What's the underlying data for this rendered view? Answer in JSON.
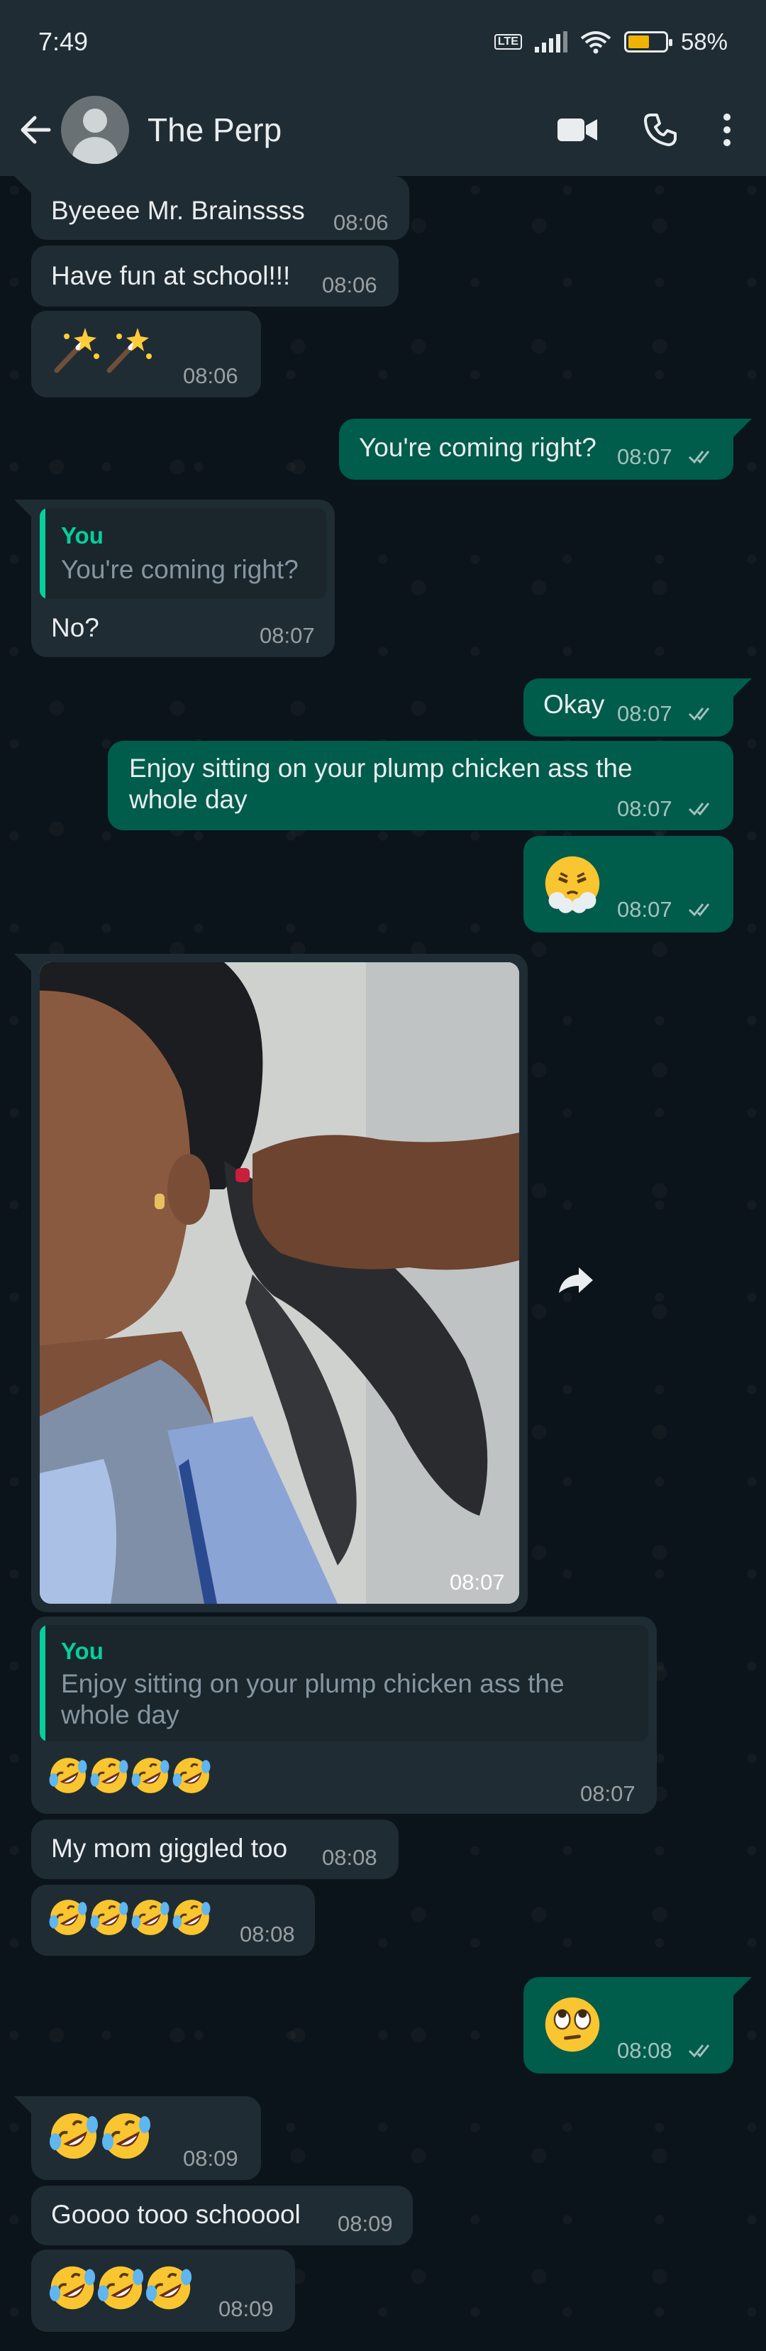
{
  "status_bar": {
    "time": "7:49",
    "volte": "Vo LTE",
    "battery": "58%",
    "battery_level": 0.58
  },
  "header": {
    "contact_name": "The Perp"
  },
  "messages": {
    "m1": {
      "text": "Byeeee Mr. Brainssss",
      "time": "08:06"
    },
    "m2": {
      "text": "Have fun at school!!!",
      "time": "08:06"
    },
    "m3": {
      "emoji": "wand-sparkles-emoji x2",
      "time": "08:06"
    },
    "m4": {
      "text": "You're coming right?",
      "time": "08:07"
    },
    "m5": {
      "quote_author": "You",
      "quote_text": "You're coming right?",
      "text": "No?",
      "time": "08:07"
    },
    "m6": {
      "text": "Okay",
      "time": "08:07"
    },
    "m7": {
      "line1": "Enjoy sitting on your plump chicken ass the",
      "line2": "whole day",
      "time": "08:07"
    },
    "m8": {
      "emoji": "face-with-steam-emoji",
      "time": "08:07"
    },
    "m9": {
      "media": "photo",
      "time": "08:07"
    },
    "m10": {
      "quote_author": "You",
      "quote_line1": "Enjoy sitting on your plump chicken ass the",
      "quote_line2": "whole day",
      "emoji": "rolling-on-floor-laughing-emoji x4",
      "time": "08:07"
    },
    "m11": {
      "text": "My mom giggled too",
      "time": "08:08"
    },
    "m12": {
      "emoji": "rolling-on-floor-laughing-emoji x4",
      "time": "08:08"
    },
    "m13": {
      "emoji": "face-with-rolling-eyes-emoji",
      "time": "08:08"
    },
    "m14": {
      "emoji": "rolling-on-floor-laughing-emoji x2",
      "time": "08:09"
    },
    "m15": {
      "text": "Goooo tooo schooool",
      "time": "08:09"
    },
    "m16": {
      "emoji": "rolling-on-floor-laughing-emoji x3",
      "time": "08:09"
    }
  },
  "colors": {
    "incoming": "#202c33",
    "outgoing": "#005c4b",
    "header": "#1f2c34",
    "accent": "#06cf9c"
  }
}
